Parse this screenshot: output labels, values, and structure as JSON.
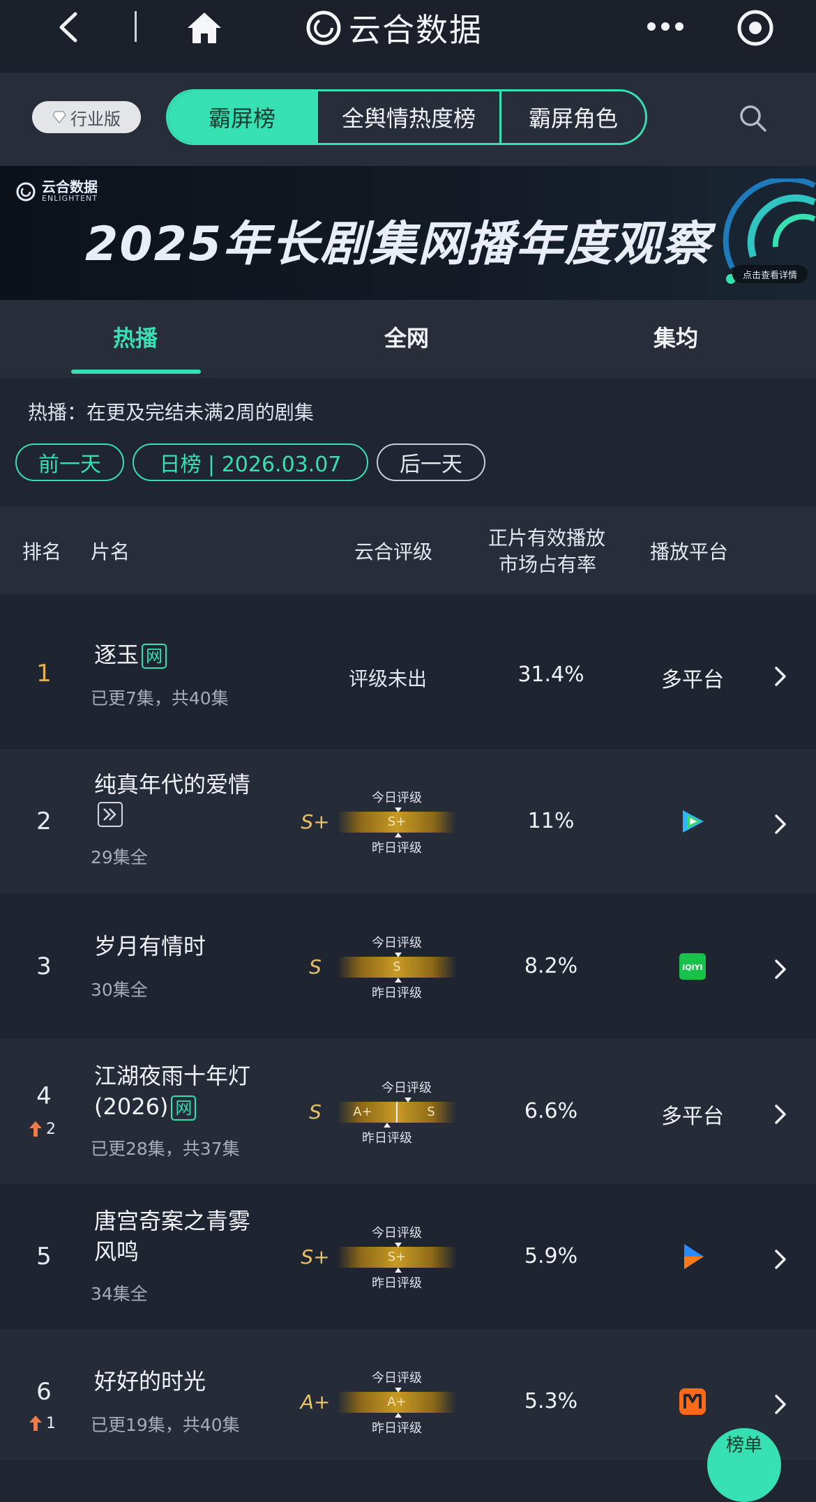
{
  "topbar": {
    "title": "云合数据"
  },
  "nav": {
    "industry_badge": "行业版",
    "segments": [
      "霸屏榜",
      "全舆情热度榜",
      "霸屏角色"
    ]
  },
  "banner": {
    "logo_cn": "云合数据",
    "logo_en": "ENLIGHTENT",
    "title": "2025年长剧集网播年度观察",
    "cta": "点击查看详情"
  },
  "tabs": [
    "热播",
    "全网",
    "集均"
  ],
  "description": "热播：在更及完结未满2周的剧集",
  "date_nav": {
    "prev": "前一天",
    "current": "日榜 | 2026.03.07",
    "next": "后一天"
  },
  "table_header": {
    "rank": "排名",
    "title": "片名",
    "rating": "云合评级",
    "share_line1": "正片有效播放",
    "share_line2": "市场占有率",
    "platform": "播放平台"
  },
  "gauge_labels": {
    "today": "今日评级",
    "yesterday": "昨日评级"
  },
  "rows": [
    {
      "rank": "1",
      "title": "逐玉",
      "tag": "网",
      "subtitle": "已更7集，共40集",
      "rating_text": "评级未出",
      "share": "31.4%",
      "platform": "多平台"
    },
    {
      "rank": "2",
      "title": "纯真年代的爱情",
      "subtitle": "29集全",
      "grade": "S+",
      "bar_grade": "S+",
      "share": "11%",
      "platform_icon": "tencent-video-icon"
    },
    {
      "rank": "3",
      "title": "岁月有情时",
      "subtitle": "30集全",
      "grade": "S",
      "bar_grade": "S",
      "share": "8.2%",
      "platform_icon": "iqiyi-icon"
    },
    {
      "rank": "4",
      "trend": "2",
      "title_line1": "江湖夜雨十年灯",
      "title_line2": "(2026)",
      "tag": "网",
      "subtitle": "已更28集，共37集",
      "grade": "S",
      "bar_left": "A+",
      "bar_right": "S",
      "share": "6.6%",
      "platform": "多平台"
    },
    {
      "rank": "5",
      "title_line1": "唐宫奇案之青雾",
      "title_line2": "风鸣",
      "subtitle": "34集全",
      "grade": "S+",
      "bar_grade": "S+",
      "share": "5.9%",
      "platform_icon": "youku-icon"
    },
    {
      "rank": "6",
      "trend": "1",
      "title": "好好的时光",
      "subtitle": "已更19集，共40集",
      "grade": "A+",
      "bar_grade": "A+",
      "share": "5.3%",
      "platform_icon": "mgtv-icon"
    }
  ],
  "fab": {
    "label": "榜单"
  },
  "colors": {
    "accent": "#37e0b0",
    "gold": "#e9c36a",
    "bg": "#1f2531"
  }
}
